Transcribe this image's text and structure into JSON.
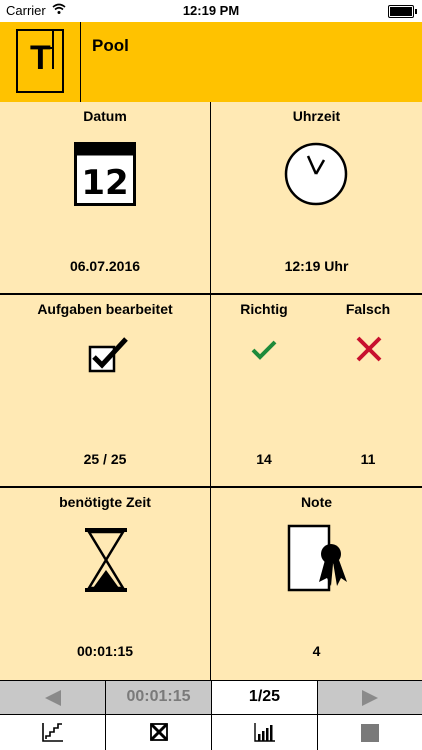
{
  "status": {
    "carrier": "Carrier",
    "time": "12:19 PM"
  },
  "header": {
    "title": "Pool"
  },
  "cells": {
    "date": {
      "label": "Datum",
      "icon_day": "12",
      "value": "06.07.2016"
    },
    "time": {
      "label": "Uhrzeit",
      "value": "12:19 Uhr"
    },
    "tasks": {
      "label": "Aufgaben bearbeitet",
      "value": "25 / 25"
    },
    "right": {
      "label": "Richtig",
      "value": "14",
      "color": "#1e8a3a"
    },
    "wrong": {
      "label": "Falsch",
      "value": "11",
      "color": "#c8102e"
    },
    "duration": {
      "label": "benötigte Zeit",
      "value": "00:01:15"
    },
    "grade": {
      "label": "Note",
      "value": "4"
    }
  },
  "nav": {
    "timer": "00:01:15",
    "page": "1/25"
  }
}
